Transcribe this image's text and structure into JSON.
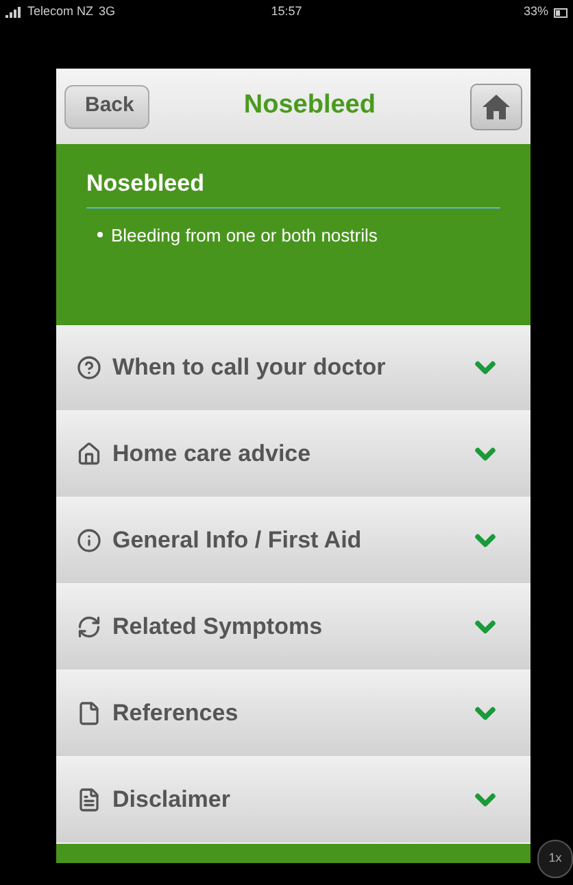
{
  "status_bar": {
    "carrier": "Telecom NZ",
    "network": "3G",
    "time": "15:57",
    "battery": "33%"
  },
  "header": {
    "back": "Back",
    "title": "Nosebleed"
  },
  "summary": {
    "title": "Nosebleed",
    "bullets": [
      "Bleeding from one or both nostrils"
    ]
  },
  "sections": [
    {
      "label": "When to call your doctor",
      "kind": "question",
      "expanded": false
    },
    {
      "label": "Home care advice",
      "kind": "home",
      "expanded": false
    },
    {
      "label": "General Info / First Aid",
      "kind": "info",
      "expanded": false
    },
    {
      "label": "Related Symptoms",
      "kind": "refresh",
      "expanded": false
    },
    {
      "label": "References",
      "kind": "file",
      "expanded": false
    },
    {
      "label": "Disclaimer",
      "kind": "document",
      "expanded": false
    }
  ],
  "zoom_button": "1x"
}
